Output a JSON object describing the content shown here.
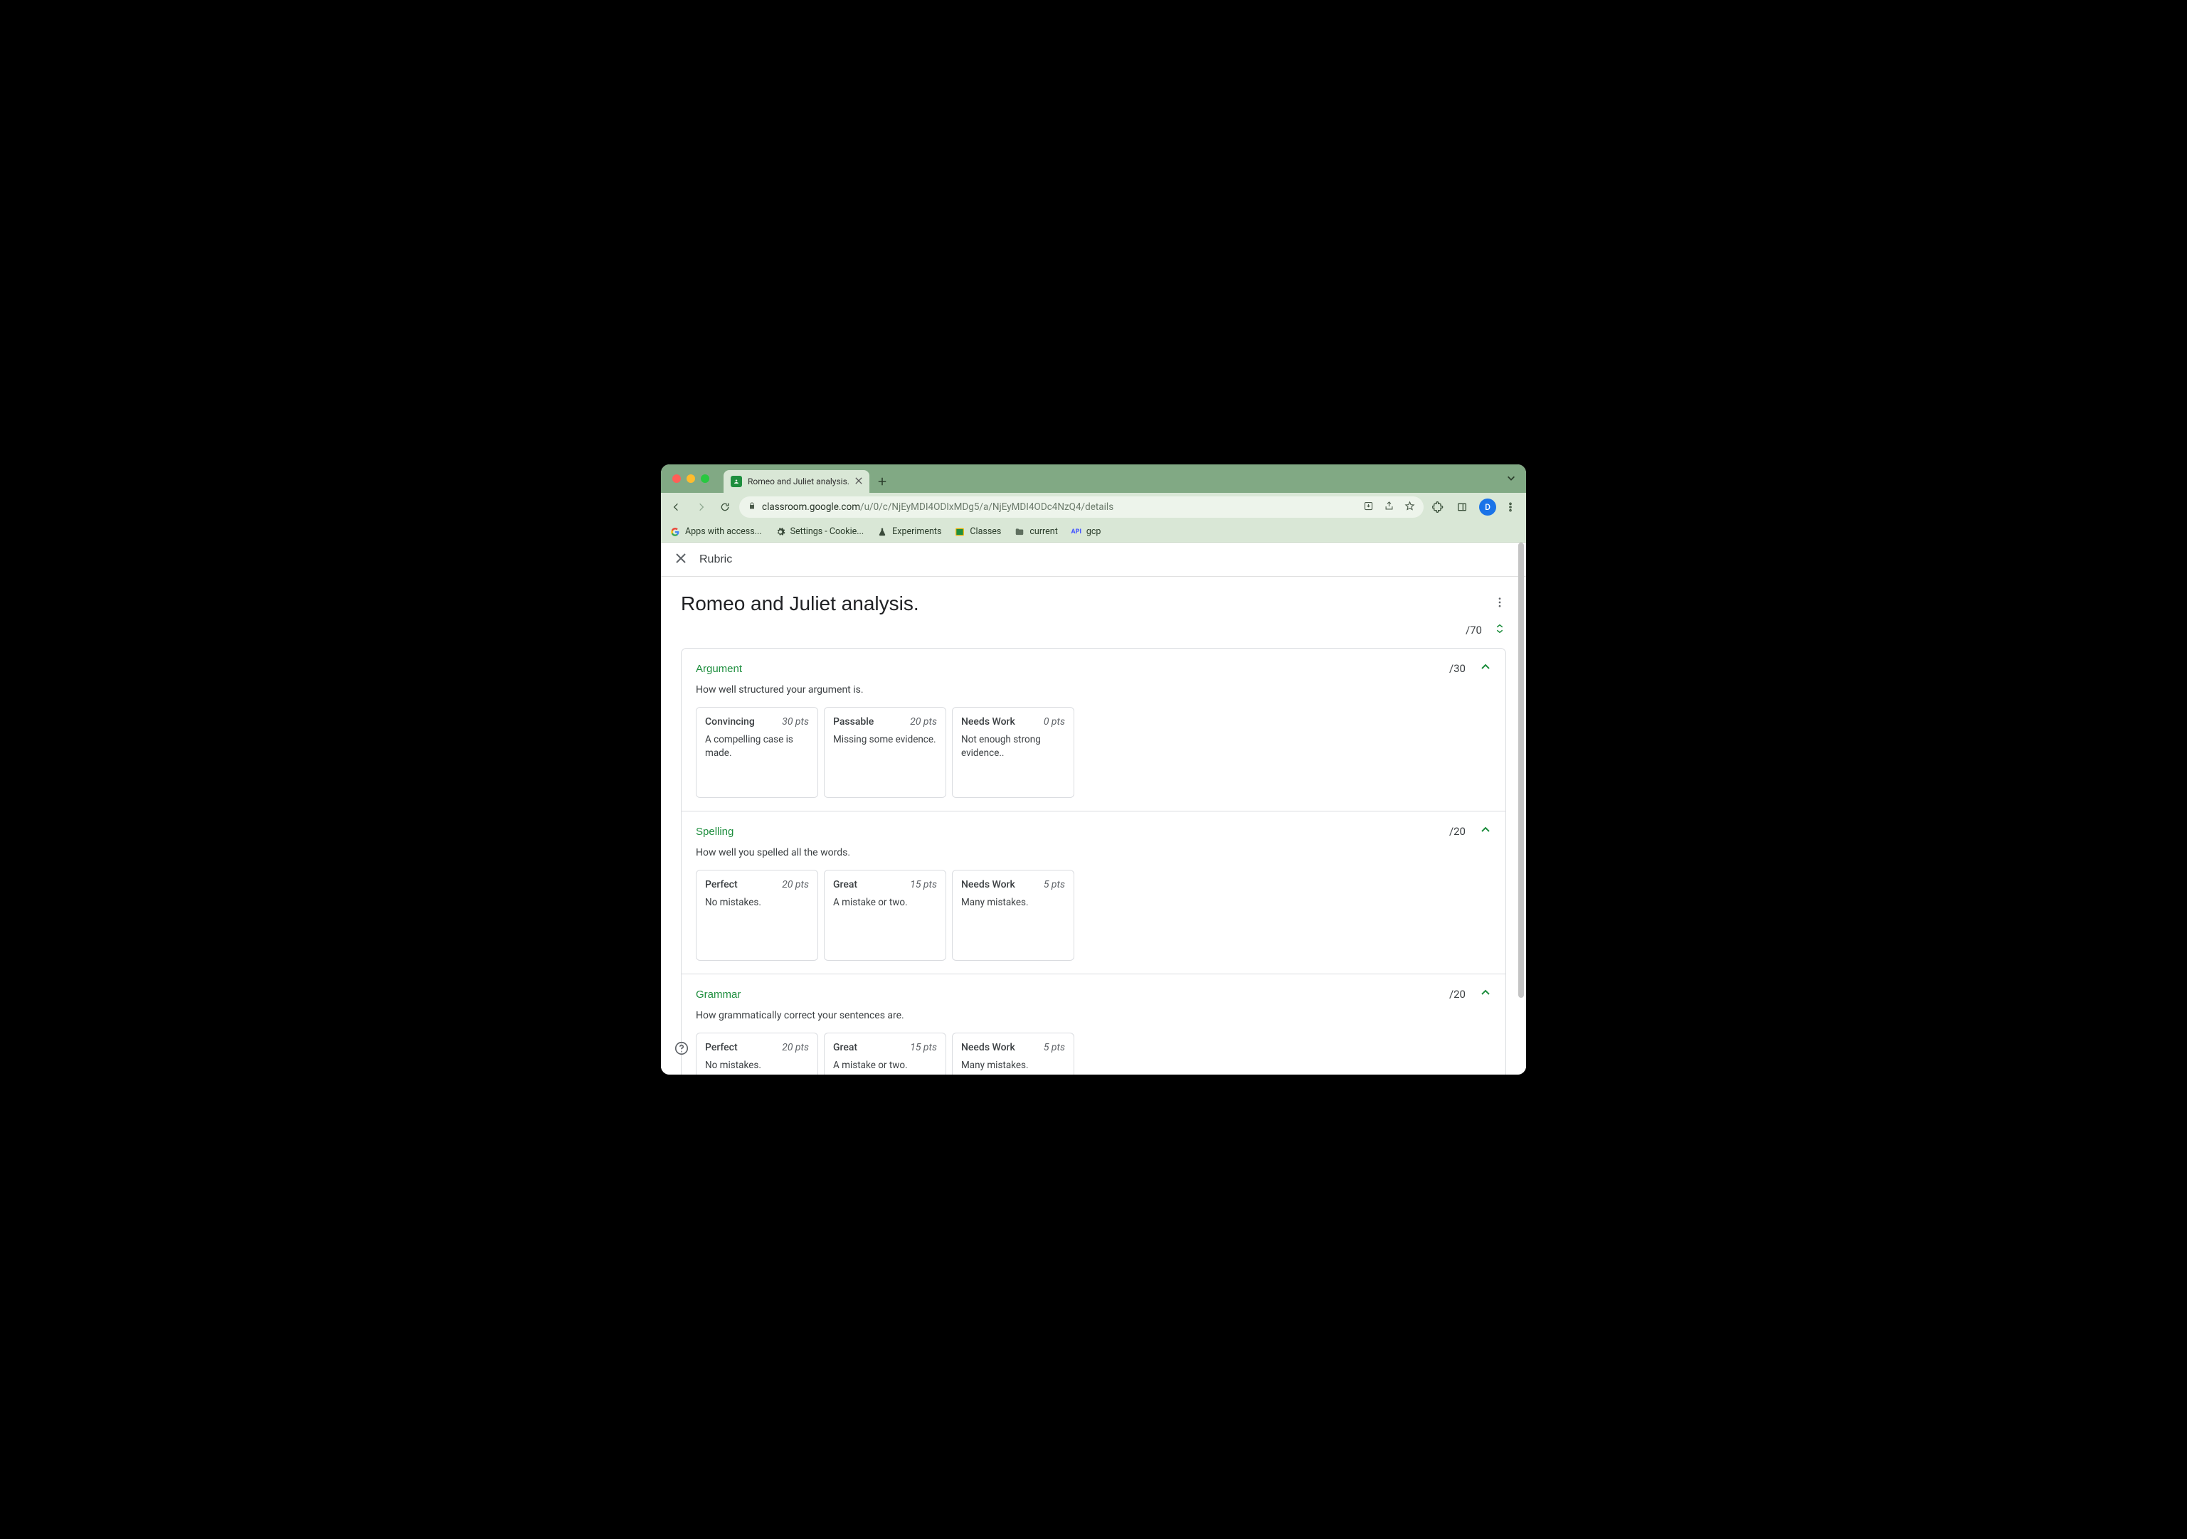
{
  "browser": {
    "tabs": [
      {
        "title": "Romeo and Juliet analysis."
      }
    ],
    "url_host": "classroom.google.com",
    "url_path": "/u/0/c/NjEyMDI4ODIxMDg5/a/NjEyMDI4ODc4NzQ4/details",
    "avatar_initial": "D",
    "bookmarks": [
      {
        "label": "Apps with access...",
        "icon": "google"
      },
      {
        "label": "Settings - Cookie...",
        "icon": "gear"
      },
      {
        "label": "Experiments",
        "icon": "flask"
      },
      {
        "label": "Classes",
        "icon": "classroom"
      },
      {
        "label": "current",
        "icon": "folder"
      },
      {
        "label": "gcp",
        "icon": "api"
      }
    ]
  },
  "appbar": {
    "title": "Rubric"
  },
  "rubric": {
    "title": "Romeo and Juliet analysis.",
    "total_points": "/70",
    "criteria": [
      {
        "name": "Argument",
        "points": "/30",
        "description": "How well structured your argument is.",
        "levels": [
          {
            "name": "Convincing",
            "points": "30 pts",
            "description": "A compelling case is made."
          },
          {
            "name": "Passable",
            "points": "20 pts",
            "description": "Missing some evidence."
          },
          {
            "name": "Needs Work",
            "points": "0 pts",
            "description": "Not enough strong evidence.."
          }
        ]
      },
      {
        "name": "Spelling",
        "points": "/20",
        "description": "How well you spelled all the words.",
        "levels": [
          {
            "name": "Perfect",
            "points": "20 pts",
            "description": "No mistakes."
          },
          {
            "name": "Great",
            "points": "15 pts",
            "description": "A mistake or two."
          },
          {
            "name": "Needs Work",
            "points": "5 pts",
            "description": "Many mistakes."
          }
        ]
      },
      {
        "name": "Grammar",
        "points": "/20",
        "description": "How grammatically correct your sentences are.",
        "levels": [
          {
            "name": "Perfect",
            "points": "20 pts",
            "description": "No mistakes."
          },
          {
            "name": "Great",
            "points": "15 pts",
            "description": "A mistake or two."
          },
          {
            "name": "Needs Work",
            "points": "5 pts",
            "description": "Many mistakes."
          }
        ]
      }
    ]
  }
}
